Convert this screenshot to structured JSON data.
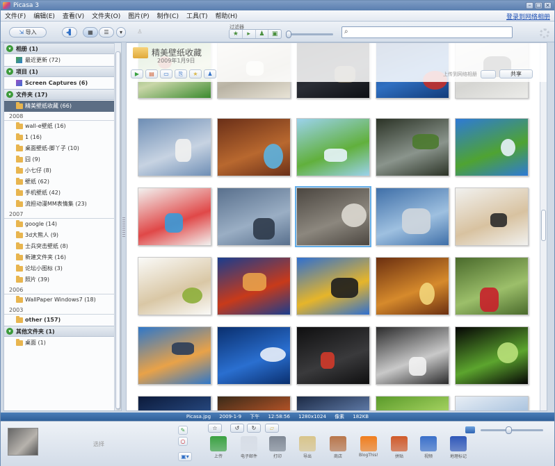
{
  "window": {
    "title": "Picasa 3"
  },
  "menu": {
    "items": [
      "文件(F)",
      "编辑(E)",
      "查看(V)",
      "文件夹(O)",
      "图片(P)",
      "制作(C)",
      "工具(T)",
      "帮助(H)"
    ],
    "signin": "登录到网络相册"
  },
  "toolbar": {
    "import_label": "导入",
    "filter_label": "过滤器",
    "filter_icons": [
      "★",
      "▸",
      "♟",
      "▣"
    ],
    "search_placeholder": ""
  },
  "sidebar": {
    "rows": [
      {
        "kind": "head",
        "label": "相册 (1)"
      },
      {
        "kind": "item",
        "label": "最近更新 (72)",
        "icon": "recent"
      },
      {
        "kind": "head",
        "label": "项目 (1)"
      },
      {
        "kind": "item",
        "label": "Screen Captures (6)",
        "icon": "capture",
        "bold": true
      },
      {
        "kind": "head",
        "label": "文件夹 (17)"
      },
      {
        "kind": "item",
        "label": "精美壁纸收藏 (66)",
        "selected": true
      },
      {
        "kind": "year",
        "label": "2008"
      },
      {
        "kind": "item",
        "label": "wall-e壁纸 (16)"
      },
      {
        "kind": "item",
        "label": "1 (16)"
      },
      {
        "kind": "item",
        "label": "桌面壁纸-脚丫子 (10)"
      },
      {
        "kind": "item",
        "label": "囧 (9)"
      },
      {
        "kind": "item",
        "label": "小七仔 (8)"
      },
      {
        "kind": "item",
        "label": "壁纸 (62)"
      },
      {
        "kind": "item",
        "label": "手机壁纸 (42)"
      },
      {
        "kind": "item",
        "label": "流担动漫MM表情集 (23)"
      },
      {
        "kind": "year",
        "label": "2007"
      },
      {
        "kind": "item",
        "label": "google (14)"
      },
      {
        "kind": "item",
        "label": "3d大熊人 (9)"
      },
      {
        "kind": "item",
        "label": "士兵突击壁纸 (8)"
      },
      {
        "kind": "item",
        "label": "新建文件夹 (16)"
      },
      {
        "kind": "item",
        "label": "论坛小图标 (3)"
      },
      {
        "kind": "item",
        "label": "照片 (39)"
      },
      {
        "kind": "year",
        "label": "2006"
      },
      {
        "kind": "item",
        "label": "WallPaper Windows7 (18)"
      },
      {
        "kind": "year",
        "label": "2003"
      },
      {
        "kind": "item",
        "label": "other (157)",
        "bold": true
      },
      {
        "kind": "head",
        "label": "其他文件夹 (1)"
      },
      {
        "kind": "item",
        "label": "桌面 (1)"
      }
    ]
  },
  "album": {
    "title": "精美壁纸收藏",
    "date": "2009年1月9日",
    "share_label": "共享",
    "share_hint": "上传到网络相册"
  },
  "grid": {
    "thumbs": [
      {
        "name": "mario-mushroom",
        "colors": [
          "#3b8a2e",
          "#c9d6a8",
          "#b23a28"
        ]
      },
      {
        "name": "white-dots",
        "colors": [
          "#e8e3d6",
          "#b9b3a4",
          "#f5f2ea"
        ]
      },
      {
        "name": "night-city",
        "colors": [
          "#0d0f14",
          "#2a2d35",
          "#6a6250"
        ]
      },
      {
        "name": "blue-bug",
        "colors": [
          "#123c7a",
          "#2f6fc1",
          "#c4302a"
        ]
      },
      {
        "name": "penguin-robots",
        "colors": [
          "#ecece9",
          "#d5d5d2",
          "#3a3a3a"
        ]
      },
      {
        "name": "sheep-pair",
        "colors": [
          "#6e8eb5",
          "#c7d3e2",
          "#f1f1ef"
        ]
      },
      {
        "name": "glass-tube",
        "colors": [
          "#6a2f18",
          "#b8682f",
          "#5cb3e0"
        ]
      },
      {
        "name": "green-island",
        "colors": [
          "#9bd2ec",
          "#61b03c",
          "#e8f4fb"
        ]
      },
      {
        "name": "sphere-field",
        "colors": [
          "#2b3326",
          "#8a948c",
          "#4b7a2e"
        ]
      },
      {
        "name": "green-hill",
        "colors": [
          "#2e7ad6",
          "#4fa332",
          "#e8f2fb"
        ]
      },
      {
        "name": "candy-faces",
        "colors": [
          "#f2f2f0",
          "#e04848",
          "#3a9ad8"
        ]
      },
      {
        "name": "robot-walle",
        "colors": [
          "#59708d",
          "#9aaec4",
          "#2d3a4a"
        ]
      },
      {
        "name": "planes-dark",
        "colors": [
          "#4b4640",
          "#8c877e",
          "#dcd8d0"
        ]
      },
      {
        "name": "airplane-sky",
        "colors": [
          "#3f6fa8",
          "#9ec0e0",
          "#cfd6dd"
        ]
      },
      {
        "name": "glasses-dog",
        "colors": [
          "#f1f1ef",
          "#d8c2a0",
          "#2a2a2a"
        ]
      },
      {
        "name": "kitten",
        "colors": [
          "#fafaf8",
          "#d9c7a5",
          "#8dae3a"
        ]
      },
      {
        "name": "red-cat",
        "colors": [
          "#1a3d8e",
          "#c83a1a",
          "#e9a24a"
        ]
      },
      {
        "name": "happy-feet",
        "colors": [
          "#2f6fd0",
          "#e6b52a",
          "#1d1d1d"
        ]
      },
      {
        "name": "orange-cheese",
        "colors": [
          "#6b2f10",
          "#d68a2c",
          "#f2d57a"
        ]
      },
      {
        "name": "red-car",
        "colors": [
          "#4a6a2c",
          "#9cbf6a",
          "#c8202a"
        ]
      },
      {
        "name": "game-hero",
        "colors": [
          "#2f77c9",
          "#e9a248",
          "#2b3d59"
        ]
      },
      {
        "name": "apple-blue",
        "colors": [
          "#0a2f6e",
          "#2a6fd0",
          "#e8eef8"
        ]
      },
      {
        "name": "dark-swirl",
        "colors": [
          "#0f0f10",
          "#3a3a3c",
          "#d23a2a"
        ]
      },
      {
        "name": "silver-mouse",
        "colors": [
          "#2b2b2c",
          "#c9c9c9",
          "#f2f2f2"
        ]
      },
      {
        "name": "green-streaks",
        "colors": [
          "#050505",
          "#5ca52e",
          "#b9e07a"
        ]
      },
      {
        "name": "row6-a",
        "colors": [
          "#0c1a3a",
          "#2a4f8a",
          "#0c1a3a"
        ]
      },
      {
        "name": "row6-b",
        "colors": [
          "#3a2a18",
          "#c95a2a",
          "#ede0c8"
        ]
      },
      {
        "name": "row6-c",
        "colors": [
          "#1c2a45",
          "#6a88b8",
          "#e7edf5"
        ]
      },
      {
        "name": "row6-d",
        "colors": [
          "#5a9a2a",
          "#b2dc6a",
          "#e6f2d0"
        ]
      },
      {
        "name": "row6-e",
        "colors": [
          "#e8eef5",
          "#9fbcdb",
          "#5a7fa8"
        ]
      }
    ]
  },
  "status": {
    "text": "Picasa.jpg    2009-1-9 下午 12:58:56    1280x1024 像素    182KB"
  },
  "tray": {
    "hold_label": "选择",
    "actions": [
      {
        "label": "上传",
        "icon": "upload-icon",
        "color": "#3aa141"
      },
      {
        "label": "电子邮件",
        "icon": "email-icon",
        "color": "#d7dde6"
      },
      {
        "label": "打印",
        "icon": "print-icon",
        "color": "#7f8894"
      },
      {
        "label": "导出",
        "icon": "export-icon",
        "color": "#d8c48a"
      },
      {
        "label": "商店",
        "icon": "shop-icon",
        "color": "#b8754a"
      },
      {
        "label": "BlogThis!",
        "icon": "blogger-icon",
        "color": "#f07d1d"
      },
      {
        "label": "拼贴",
        "icon": "collage-icon",
        "color": "#d05a2a"
      },
      {
        "label": "视频",
        "icon": "movie-icon",
        "color": "#3a6fc9"
      },
      {
        "label": "地理标记",
        "icon": "geotag-icon",
        "color": "#2f57b8"
      }
    ]
  }
}
